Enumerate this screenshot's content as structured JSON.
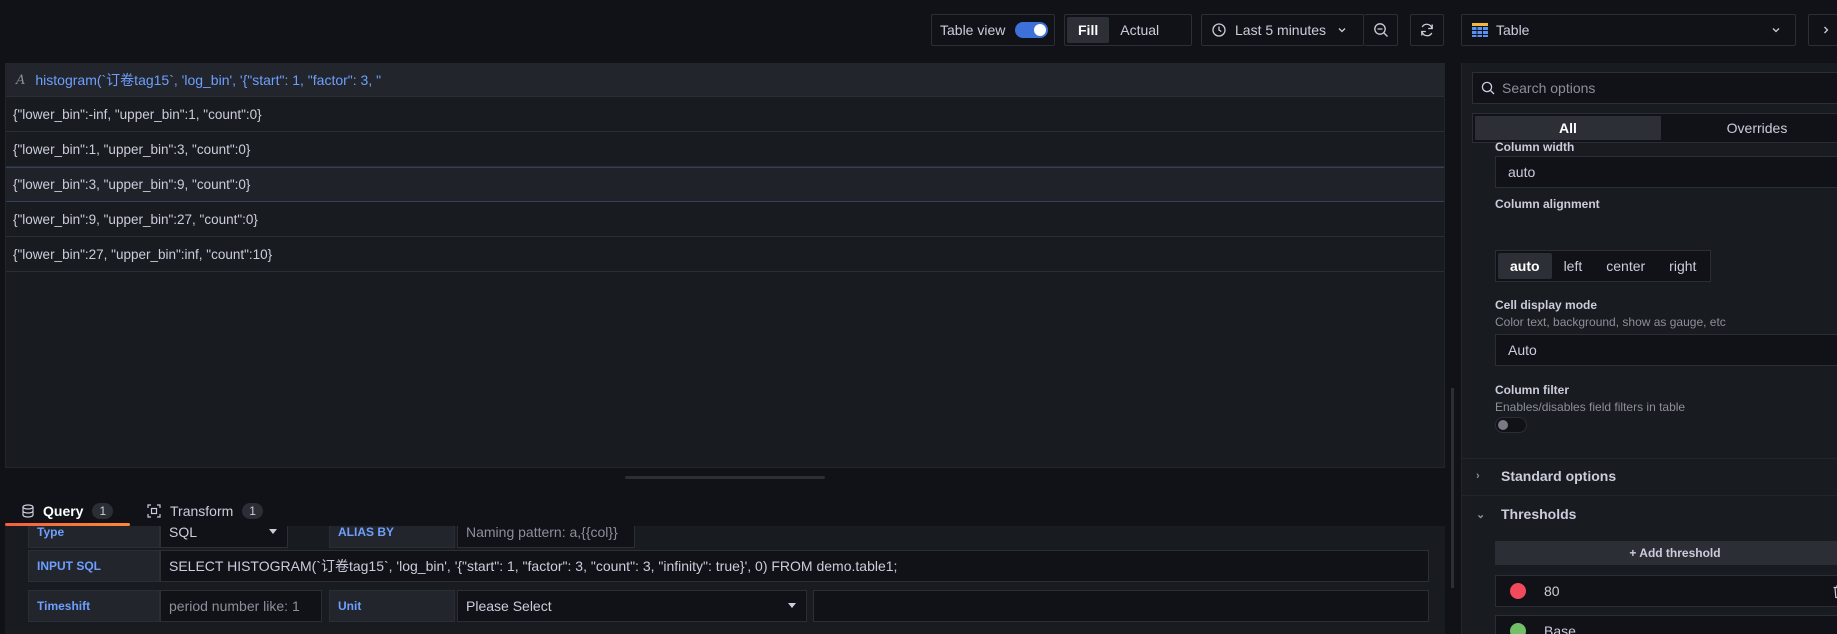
{
  "toolbar": {
    "table_view_label": "Table view",
    "table_view_on": true,
    "fill_label": "Fill",
    "actual_label": "Actual",
    "time_range": "Last 5 minutes",
    "visualization": "Table"
  },
  "panel": {
    "column_header": "histogram(`订卷tag15`, 'log_bin', '{\"start\": 1, \"factor\": 3, \"",
    "rows": [
      "{\"lower_bin\":-inf, \"upper_bin\":1, \"count\":0}",
      "{\"lower_bin\":1, \"upper_bin\":3, \"count\":0}",
      "{\"lower_bin\":3, \"upper_bin\":9, \"count\":0}",
      "{\"lower_bin\":9, \"upper_bin\":27, \"count\":0}",
      "{\"lower_bin\":27, \"upper_bin\":inf, \"count\":10}"
    ]
  },
  "tabs": {
    "query_label": "Query",
    "query_count": "1",
    "transform_label": "Transform",
    "transform_count": "1"
  },
  "query": {
    "type_label": "Type",
    "type_value": "SQL",
    "alias_label": "ALIAS BY",
    "alias_placeholder": "Naming pattern: a,{{col}}",
    "sql_label": "INPUT SQL",
    "sql_value": "SELECT HISTOGRAM(`订卷tag15`, 'log_bin', '{\"start\": 1, \"factor\": 3, \"count\": 3, \"infinity\": true}', 0) FROM demo.table1;",
    "timeshift_label": "Timeshift",
    "timeshift_placeholder": "period number like: 1",
    "unit_label": "Unit",
    "unit_placeholder": "Please Select"
  },
  "options": {
    "search_placeholder": "Search options",
    "tab_all": "All",
    "tab_overrides": "Overrides",
    "column_width_label": "Column width",
    "column_width_value": "auto",
    "column_alignment_label": "Column alignment",
    "alignments": [
      "auto",
      "left",
      "center",
      "right"
    ],
    "cell_display_label": "Cell display mode",
    "cell_display_desc": "Color text, background, show as gauge, etc",
    "cell_display_value": "Auto",
    "column_filter_label": "Column filter",
    "column_filter_desc": "Enables/disables field filters in table",
    "standard_options": "Standard options",
    "thresholds": "Thresholds",
    "add_threshold": "+ Add threshold",
    "threshold_value": "80",
    "threshold_color": "#f2495c",
    "base_label": "Base",
    "base_color": "#73bf69"
  }
}
